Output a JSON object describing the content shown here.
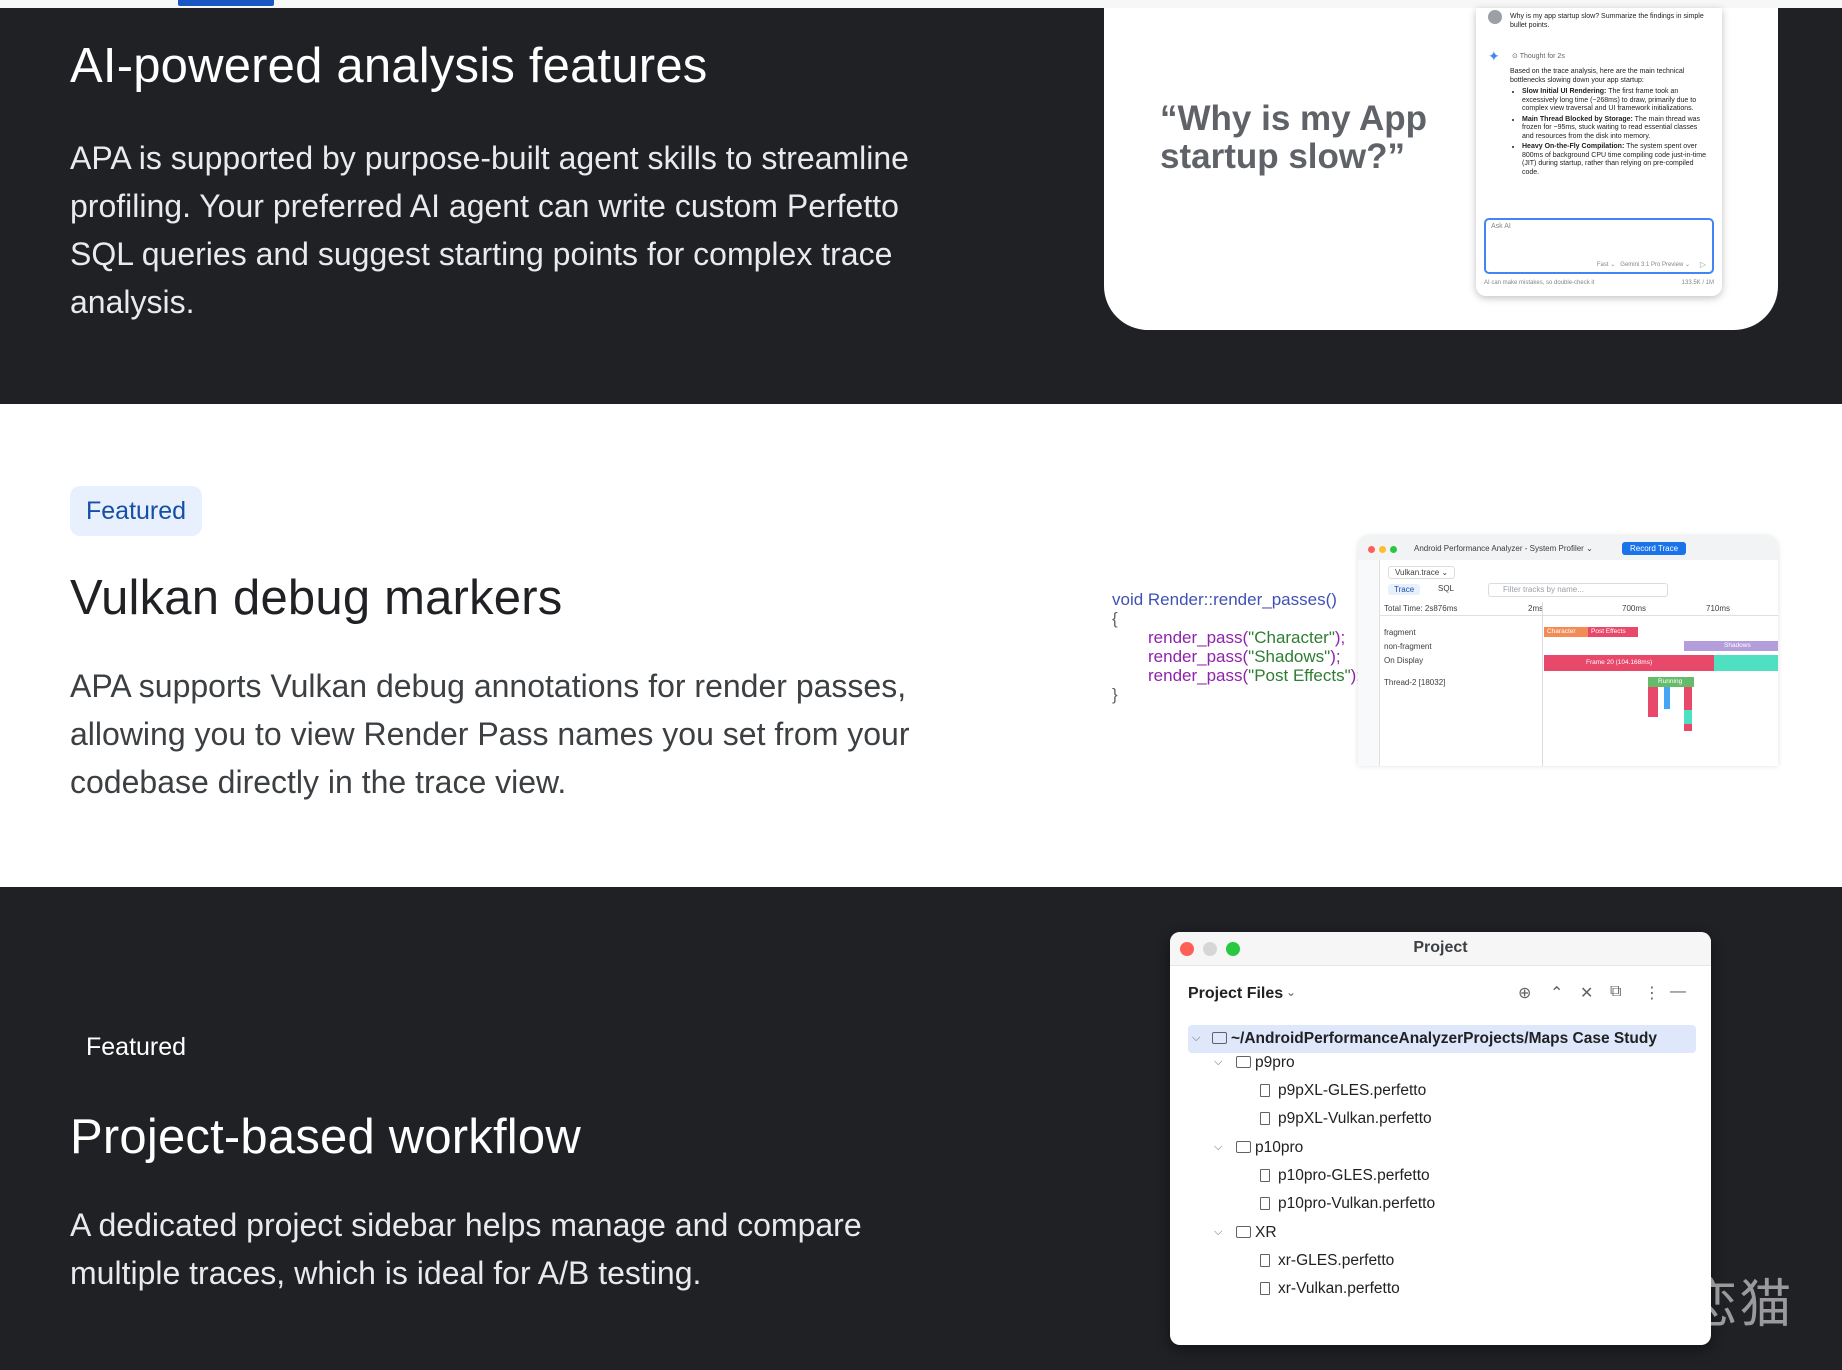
{
  "section_ai": {
    "title": "AI-powered analysis features",
    "body": "APA is supported by purpose-built agent skills to streamline profiling. Your preferred AI agent can write custom Perfetto SQL queries and suggest starting points for complex trace analysis.",
    "quote": "“Why is my App startup slow?”",
    "panel": {
      "prompt": "Why is my app startup slow? Summarize the findings in simple bullet points.",
      "thought": "Thought for 2s",
      "intro": "Based on the trace analysis, here are the main technical bottlenecks slowing down your app startup:",
      "bullets": [
        {
          "head": "Slow Initial UI Rendering:",
          "text": " The first frame took an excessively long time (~268ms) to draw, primarily due to complex view traversal and UI framework initializations."
        },
        {
          "head": "Main Thread Blocked by Storage:",
          "text": " The main thread was frozen for ~95ms, stuck waiting to read essential classes and resources from the disk into memory."
        },
        {
          "head": "Heavy On-the-Fly Compilation:",
          "text": " The system spent over 800ms of background CPU time compiling code just-in-time (JIT) during startup, rather than relying on pre-compiled code."
        }
      ],
      "ask_placeholder": "Ask AI",
      "mode": "Fast ⌄",
      "model": "Gemini 3.1 Pro Preview ⌄",
      "send_icon": "send-icon",
      "disclaimer": "AI can make mistakes, so double-check it",
      "tokens": "133.5K / 1M"
    }
  },
  "section_vulkan": {
    "chip": "Featured",
    "title": "Vulkan debug markers",
    "body": "APA supports Vulkan debug annotations for render passes, allowing you to view Render Pass names you set from your codebase directly in the trace view.",
    "code": {
      "signature": "void Render::render_passes()",
      "open": "{",
      "calls": [
        {
          "fn": "render_pass(",
          "arg": "\"Character\"",
          "end": ");"
        },
        {
          "fn": "render_pass(",
          "arg": "\"Shadows\"",
          "end": ");"
        },
        {
          "fn": "render_pass(",
          "arg": "\"Post Effects\"",
          "end": ");"
        }
      ],
      "close": "}"
    },
    "profiler": {
      "title": "Android Performance Analyzer - System Profiler ⌄",
      "record_button": "Record Trace",
      "file_tab": "Vulkan.trace ⌄",
      "trace_tab": "Trace",
      "sql_tab": "SQL",
      "filter_placeholder": "Filter tracks by name...",
      "total_time": "Total Time: 2s876ms",
      "ticks": [
        "2ms",
        "700ms",
        "710ms"
      ],
      "rows": [
        "fragment",
        "non-fragment",
        "On Display",
        "Thread-2 [18032]"
      ],
      "blocks": {
        "character": "Character",
        "post_effects": "Post Effects",
        "shadows": "Shadows",
        "frame": "Frame 20 (104.168ms)",
        "running": "Running"
      },
      "colors": {
        "character": "#f28b55",
        "post_effects": "#e8486a",
        "shadows": "#b39ddb",
        "frame": "#e8486a",
        "frame_tail": "#4ee0c0",
        "running": "#66bb6a"
      }
    }
  },
  "section_project": {
    "chip": "Featured",
    "title": "Project-based workflow",
    "body": "A dedicated project sidebar helps manage and compare multiple traces, which is ideal for A/B testing.",
    "window": {
      "title": "Project",
      "files_label": "Project Files",
      "toolbar_icons": [
        "locate-icon",
        "expand-icon",
        "collapse-icon",
        "autoscroll-icon",
        "more-icon",
        "hide-icon"
      ],
      "root": "~/AndroidPerformanceAnalyzerProjects/Maps Case Study",
      "folders": [
        {
          "name": "p9pro",
          "files": [
            "p9pXL-GLES.perfetto",
            "p9pXL-Vulkan.perfetto"
          ]
        },
        {
          "name": "p10pro",
          "files": [
            "p10pro-GLES.perfetto",
            "p10pro-Vulkan.perfetto"
          ]
        },
        {
          "name": "XR",
          "files": [
            "xr-GLES.perfetto",
            "xr-Vulkan.perfetto"
          ]
        }
      ]
    }
  },
  "watermark": "知乎 @恋猫"
}
